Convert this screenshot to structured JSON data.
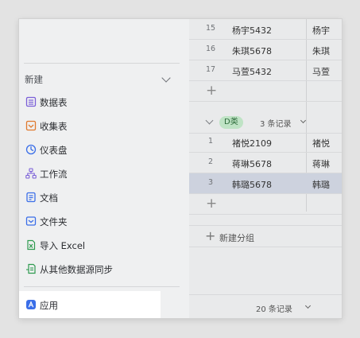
{
  "menu": {
    "title": "新建",
    "items": [
      {
        "label": "数据表",
        "icon": "datasheet-icon",
        "color": "#7b5fd8"
      },
      {
        "label": "收集表",
        "icon": "form-icon",
        "color": "#e07a2e"
      },
      {
        "label": "仪表盘",
        "icon": "dashboard-icon",
        "color": "#3a6ee8"
      },
      {
        "label": "工作流",
        "icon": "workflow-icon",
        "color": "#7b5fd8"
      },
      {
        "label": "文档",
        "icon": "document-icon",
        "color": "#3a6ee8"
      },
      {
        "label": "文件夹",
        "icon": "folder-icon",
        "color": "#3a6ee8"
      },
      {
        "label": "导入 Excel",
        "icon": "excel-import-icon",
        "color": "#2e9a4f"
      },
      {
        "label": "从其他数据源同步",
        "icon": "sync-icon",
        "color": "#2e9a4f"
      }
    ],
    "app_item": {
      "label": "应用",
      "icon": "app-icon",
      "color": "#3a6ee8"
    }
  },
  "table": {
    "top_rows": [
      {
        "num": "15",
        "name": "杨宇5432",
        "extra": "杨宇"
      },
      {
        "num": "16",
        "name": "朱琪5678",
        "extra": "朱琪"
      },
      {
        "num": "17",
        "name": "马萱5432",
        "extra": "马萱"
      }
    ],
    "group": {
      "tag": "D类",
      "count": "3 条记录"
    },
    "group_rows": [
      {
        "num": "1",
        "name": "褚悦2109",
        "extra": "褚悦"
      },
      {
        "num": "2",
        "name": "蒋琳5678",
        "extra": "蒋琳"
      },
      {
        "num": "3",
        "name": "韩璐5678",
        "extra": "韩璐"
      }
    ],
    "new_group_label": "新建分组",
    "footer_label": "20 条记录"
  }
}
